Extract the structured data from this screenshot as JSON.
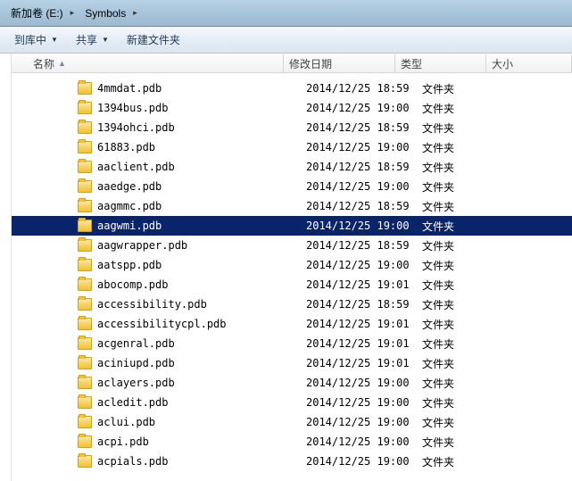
{
  "breadcrumb": {
    "seg1": "新加卷 (E:)",
    "seg2": "Symbols"
  },
  "toolbar": {
    "library": "到库中",
    "share": "共享",
    "newfolder": "新建文件夹"
  },
  "columns": {
    "name": "名称",
    "date": "修改日期",
    "type": "类型",
    "size": "大小"
  },
  "files": [
    {
      "name": "4mmdat.pdb",
      "date": "2014/12/25 18:59",
      "type": "文件夹",
      "selected": false
    },
    {
      "name": "1394bus.pdb",
      "date": "2014/12/25 19:00",
      "type": "文件夹",
      "selected": false
    },
    {
      "name": "1394ohci.pdb",
      "date": "2014/12/25 18:59",
      "type": "文件夹",
      "selected": false
    },
    {
      "name": "61883.pdb",
      "date": "2014/12/25 19:00",
      "type": "文件夹",
      "selected": false
    },
    {
      "name": "aaclient.pdb",
      "date": "2014/12/25 18:59",
      "type": "文件夹",
      "selected": false
    },
    {
      "name": "aaedge.pdb",
      "date": "2014/12/25 19:00",
      "type": "文件夹",
      "selected": false
    },
    {
      "name": "aagmmc.pdb",
      "date": "2014/12/25 18:59",
      "type": "文件夹",
      "selected": false
    },
    {
      "name": "aagwmi.pdb",
      "date": "2014/12/25 19:00",
      "type": "文件夹",
      "selected": true
    },
    {
      "name": "aagwrapper.pdb",
      "date": "2014/12/25 18:59",
      "type": "文件夹",
      "selected": false
    },
    {
      "name": "aatspp.pdb",
      "date": "2014/12/25 19:00",
      "type": "文件夹",
      "selected": false
    },
    {
      "name": "abocomp.pdb",
      "date": "2014/12/25 19:01",
      "type": "文件夹",
      "selected": false
    },
    {
      "name": "accessibility.pdb",
      "date": "2014/12/25 18:59",
      "type": "文件夹",
      "selected": false
    },
    {
      "name": "accessibilitycpl.pdb",
      "date": "2014/12/25 19:01",
      "type": "文件夹",
      "selected": false
    },
    {
      "name": "acgenral.pdb",
      "date": "2014/12/25 19:01",
      "type": "文件夹",
      "selected": false
    },
    {
      "name": "aciniupd.pdb",
      "date": "2014/12/25 19:01",
      "type": "文件夹",
      "selected": false
    },
    {
      "name": "aclayers.pdb",
      "date": "2014/12/25 19:00",
      "type": "文件夹",
      "selected": false
    },
    {
      "name": "acledit.pdb",
      "date": "2014/12/25 19:00",
      "type": "文件夹",
      "selected": false
    },
    {
      "name": "aclui.pdb",
      "date": "2014/12/25 19:00",
      "type": "文件夹",
      "selected": false
    },
    {
      "name": "acpi.pdb",
      "date": "2014/12/25 19:00",
      "type": "文件夹",
      "selected": false
    },
    {
      "name": "acpials.pdb",
      "date": "2014/12/25 19:00",
      "type": "文件夹",
      "selected": false
    }
  ]
}
